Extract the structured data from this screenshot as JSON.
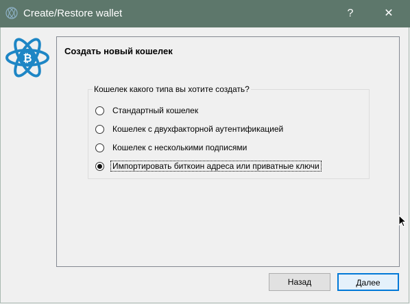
{
  "window": {
    "title": "Create/Restore wallet",
    "help_label": "?",
    "close_label": "✕"
  },
  "page": {
    "title": "Создать новый кошелек"
  },
  "wallet_type_group": {
    "legend": "Кошелек какого типа вы хотите создать?",
    "options": [
      {
        "label": "Стандартный кошелек",
        "checked": false
      },
      {
        "label": "Кошелек с двухфакторной аутентификацией",
        "checked": false
      },
      {
        "label": "Кошелек с несколькими подписями",
        "checked": false
      },
      {
        "label": "Импортировать биткоин адреса или приватные ключи",
        "checked": true
      }
    ]
  },
  "buttons": {
    "back_label": "Назад",
    "next_label": "Далее"
  },
  "colors": {
    "titlebar": "#5d776b",
    "logo": "#1e86c5",
    "accent": "#0078d7"
  }
}
